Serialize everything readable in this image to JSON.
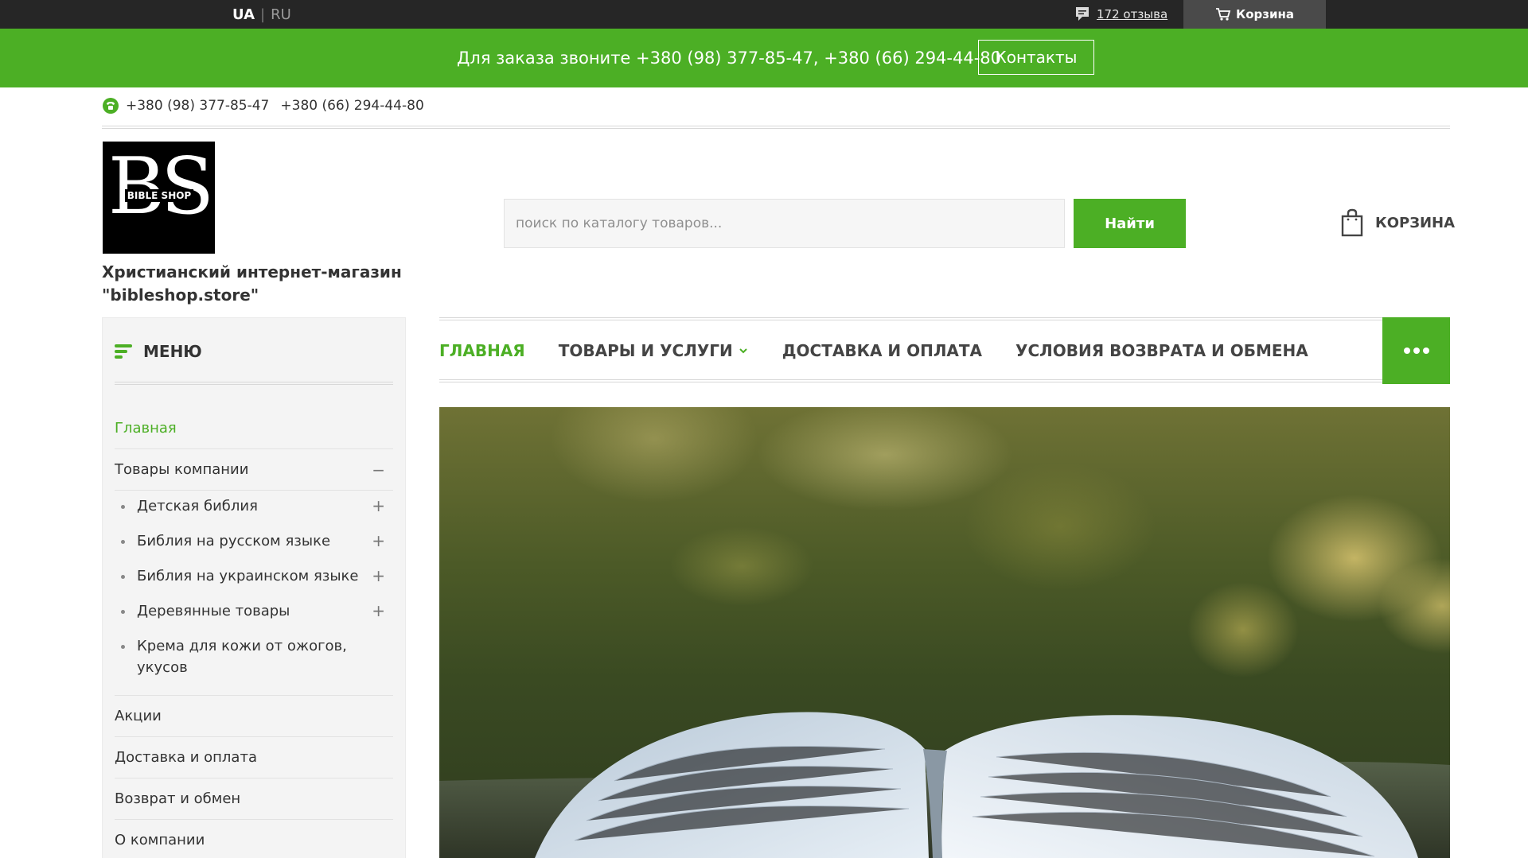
{
  "topbar": {
    "lang_ua": "UA",
    "lang_sep": "|",
    "lang_ru": "RU",
    "reviews": "172 отзыва",
    "cart": "Корзина"
  },
  "banner": {
    "order_text": "Для заказа звоните +380 (98) 377-85-47, +380 (66) 294-44-80",
    "contacts": "Контакты"
  },
  "header": {
    "phone1": "+380 (98) 377-85-47",
    "phone2": "+380 (66) 294-44-80",
    "logo_letters": "BS",
    "logo_caption": "BIBLE SHOP",
    "shop_name": "Христианский интернет-магазин \"bibleshop.store\"",
    "search_placeholder": "поиск по каталогу товаров...",
    "search_button": "Найти",
    "cart": "КОРЗИНА"
  },
  "sidemenu": {
    "title": "МЕНЮ",
    "items": [
      {
        "label": "Главная"
      },
      {
        "label": "Товары компании",
        "toggle": "−"
      },
      {
        "label": "Акции"
      },
      {
        "label": "Доставка и оплата"
      },
      {
        "label": "Возврат и обмен"
      },
      {
        "label": "О компании"
      }
    ],
    "subitems": [
      {
        "label": "Детская библия",
        "toggle": "+"
      },
      {
        "label": "Библия на русском языке",
        "toggle": "+"
      },
      {
        "label": "Библия на украинском языке",
        "toggle": "+"
      },
      {
        "label": "Деревянные товары",
        "toggle": "+"
      },
      {
        "label": "Крема для кожи от ожогов, укусов"
      }
    ]
  },
  "nav": {
    "items": [
      {
        "label": "ГЛАВНАЯ"
      },
      {
        "label": "ТОВАРЫ И УСЛУГИ"
      },
      {
        "label": "ДОСТАВКА И ОПЛАТА"
      },
      {
        "label": "УСЛОВИЯ ВОЗВРАТА И ОБМЕНА"
      }
    ]
  },
  "icons": {
    "reviews": "chat-bubble-icon",
    "topcart": "cart-icon",
    "phone": "phone-icon",
    "cart": "shopping-bag-icon",
    "menu": "menu-bars-icon",
    "chevron": "chevron-down-icon",
    "more": "more-dots-icon"
  },
  "colors": {
    "accent": "#4caf25",
    "topbar": "#262626"
  }
}
